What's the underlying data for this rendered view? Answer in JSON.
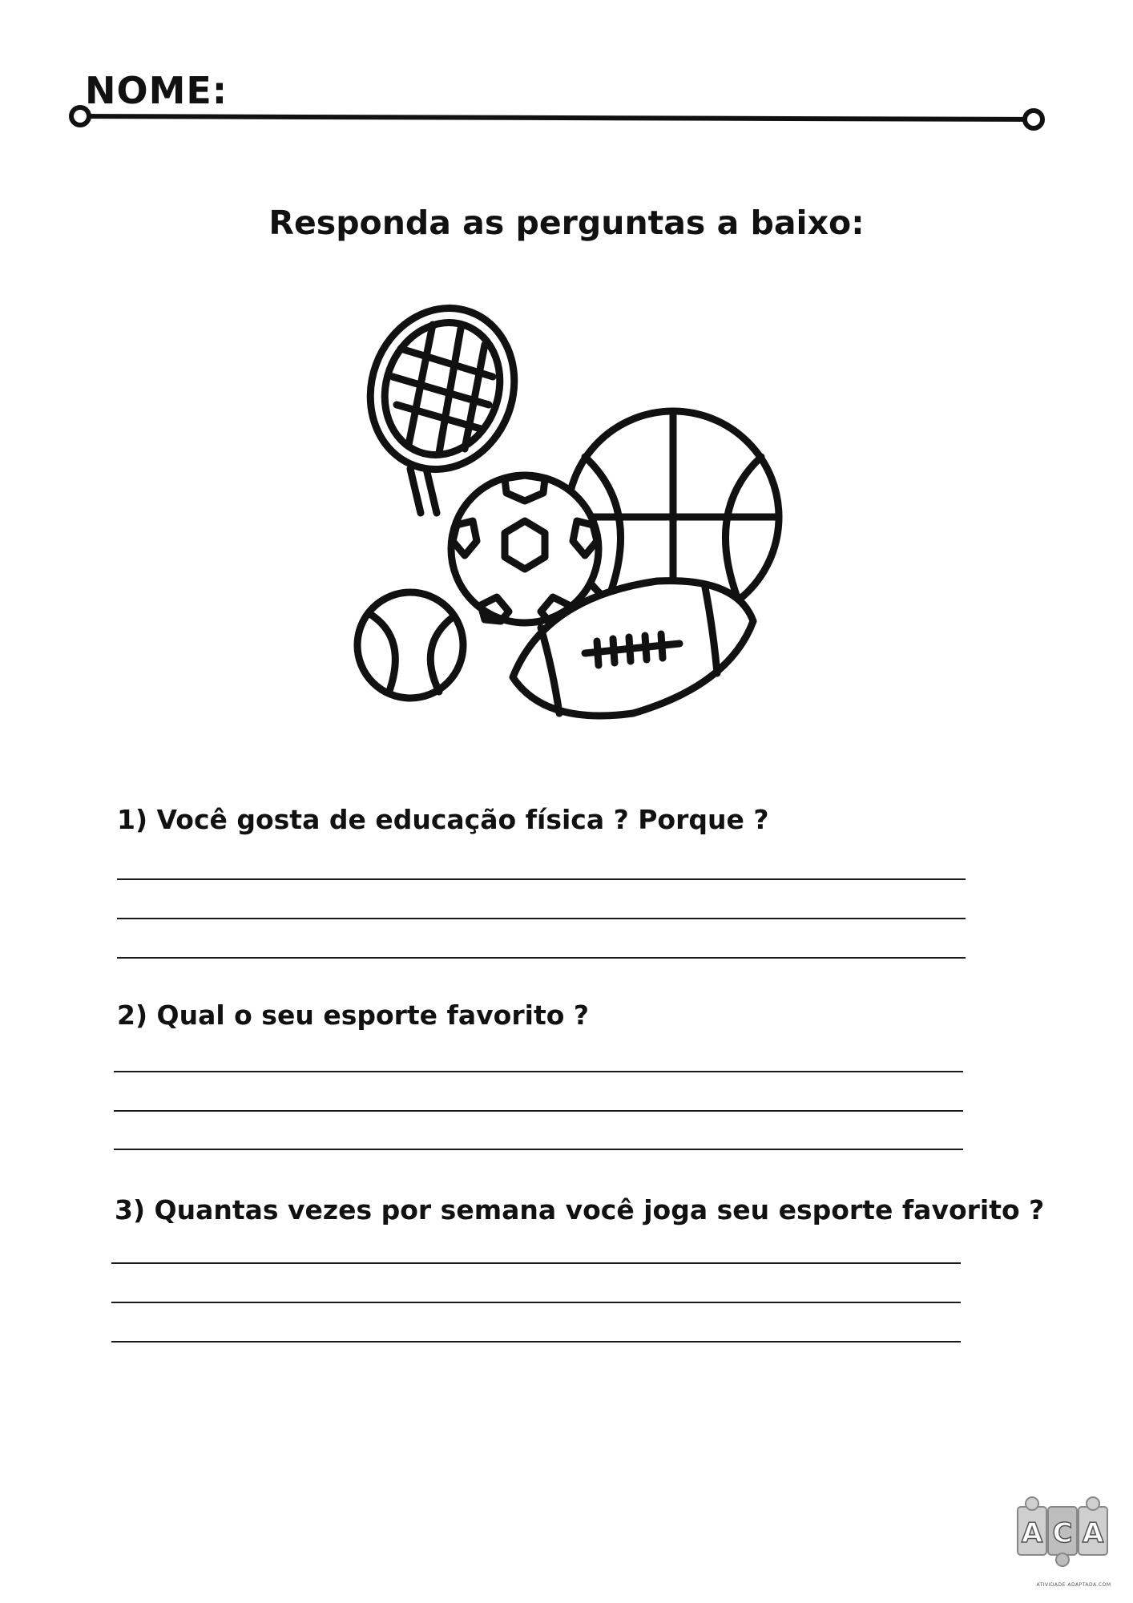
{
  "header": {
    "name_label": "NOME:"
  },
  "title": "Responda as perguntas a baixo:",
  "illustration": {
    "icon": "sports-balls-icon"
  },
  "questions": [
    {
      "text": "1) Você gosta de educação física ? Porque ?"
    },
    {
      "text": "2) Qual o seu esporte favorito ?"
    },
    {
      "text": "3) Quantas vezes por semana você joga seu esporte favorito ?"
    }
  ],
  "footer": {
    "logo_letters": "ACA",
    "logo_caption": "ATIVIDADE ADAPTADA.COM"
  }
}
